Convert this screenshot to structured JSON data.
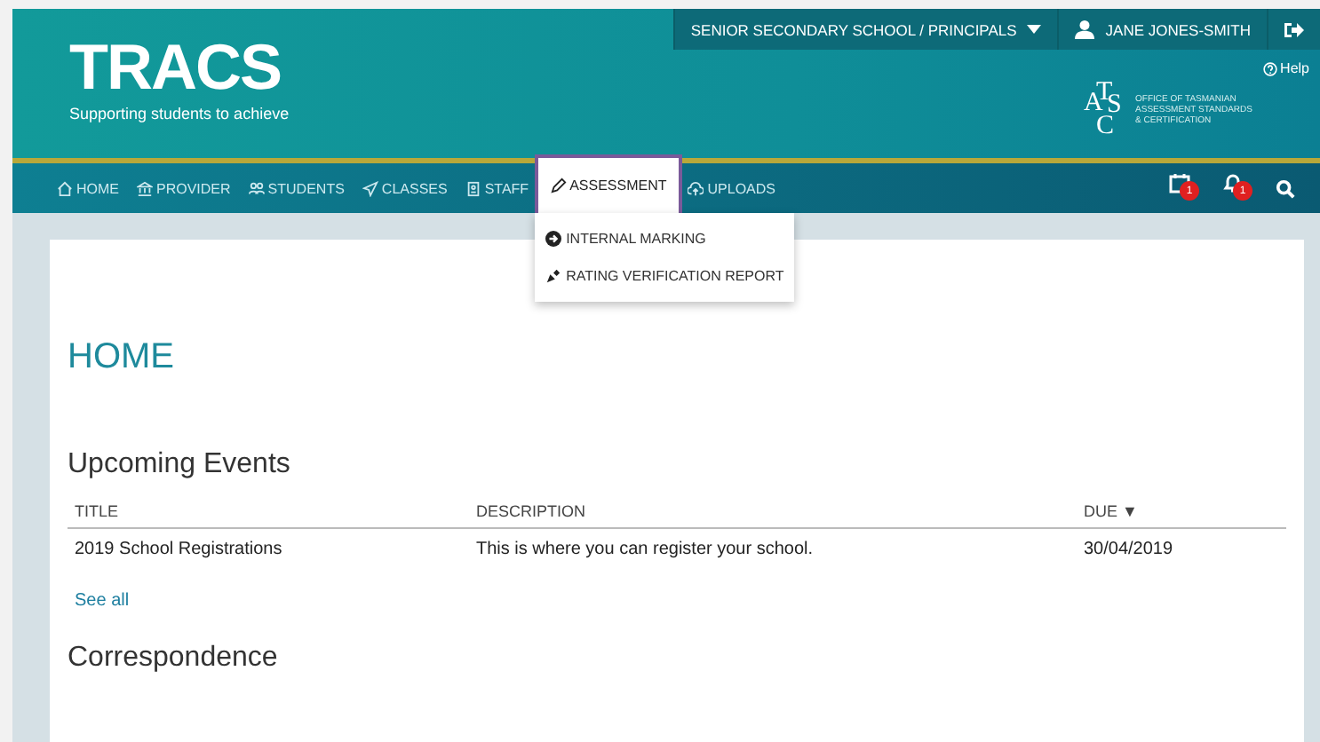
{
  "header": {
    "logo": "TRACS",
    "tagline": "Supporting students to achieve",
    "context": "SENIOR SECONDARY SCHOOL / PRINCIPALS",
    "user": "JANE JONES-SMITH",
    "help": "Help",
    "org_letters": [
      "A",
      "T",
      "S",
      "C"
    ],
    "org_lines": [
      "OFFICE OF TASMANIAN",
      "ASSESSMENT STANDARDS",
      "& CERTIFICATION"
    ]
  },
  "nav": [
    {
      "label": "HOME",
      "selected": false
    },
    {
      "label": "PROVIDER",
      "selected": false
    },
    {
      "label": "STUDENTS",
      "selected": false
    },
    {
      "label": "CLASSES",
      "selected": false
    },
    {
      "label": "STAFF",
      "selected": false
    },
    {
      "label": "ASSESSMENT",
      "selected": true
    },
    {
      "label": "UPLOADS",
      "selected": false
    }
  ],
  "nav_badges": [
    {
      "count": "1"
    },
    {
      "count": "1"
    }
  ],
  "dropdown": [
    {
      "label": "INTERNAL MARKING"
    },
    {
      "label": "RATING VERIFICATION REPORT"
    }
  ],
  "page_title": "HOME",
  "events": {
    "title": "Upcoming Events",
    "columns": [
      "TITLE",
      "DESCRIPTION",
      "DUE ▼"
    ],
    "rows": [
      [
        "2019 School Registrations",
        "This is where you can register your school.",
        "30/04/2019"
      ]
    ],
    "see_all": "See all"
  },
  "correspondence": {
    "title": "Correspondence"
  }
}
